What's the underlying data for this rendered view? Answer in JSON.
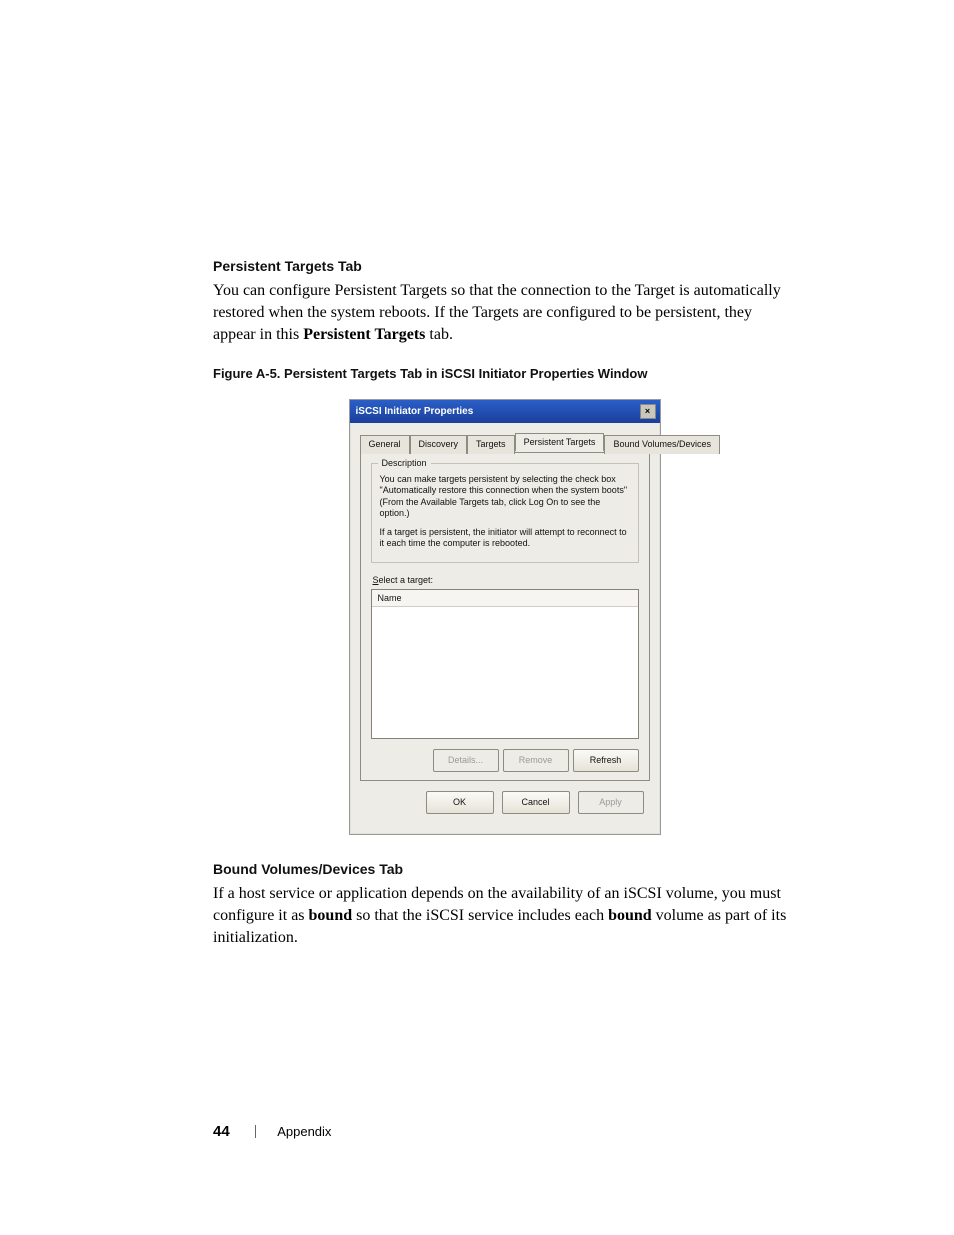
{
  "sections": {
    "persistent": {
      "heading": "Persistent Targets Tab",
      "para_pre": "You can configure Persistent Targets so that the connection to the Target is automatically restored when the system reboots. If the Targets are configured to be persistent, they appear in this ",
      "para_bold": "Persistent Targets",
      "para_post": " tab."
    },
    "figure": {
      "caption": "Figure A-5.    Persistent Targets Tab in iSCSI Initiator Properties Window"
    },
    "bound": {
      "heading": "Bound Volumes/Devices Tab",
      "para_pre": "If a host service or application depends on the availability of an iSCSI volume, you must configure it as ",
      "para_bold1": "bound",
      "para_mid": " so that the iSCSI service includes each ",
      "para_bold2": "bound",
      "para_post": " volume as part of its initialization."
    }
  },
  "dialog": {
    "title": "iSCSI Initiator Properties",
    "tabs": {
      "general": "General",
      "discovery": "Discovery",
      "targets": "Targets",
      "persistent": "Persistent Targets",
      "bound": "Bound Volumes/Devices"
    },
    "group_legend": "Description",
    "desc1": "You can make targets persistent by selecting the check box \"Automatically restore this connection when the system boots\" (From the Available Targets tab, click Log On to see the option.)",
    "desc2": "If a target is persistent, the initiator will attempt to reconnect to it each time the computer is rebooted.",
    "select_prefix": "S",
    "select_rest": "elect a target:",
    "list_header": "Name",
    "buttons": {
      "details": "Details...",
      "remove": "Remove",
      "refresh": "Refresh",
      "ok": "OK",
      "cancel": "Cancel",
      "apply": "Apply"
    }
  },
  "footer": {
    "page": "44",
    "section": "Appendix"
  }
}
